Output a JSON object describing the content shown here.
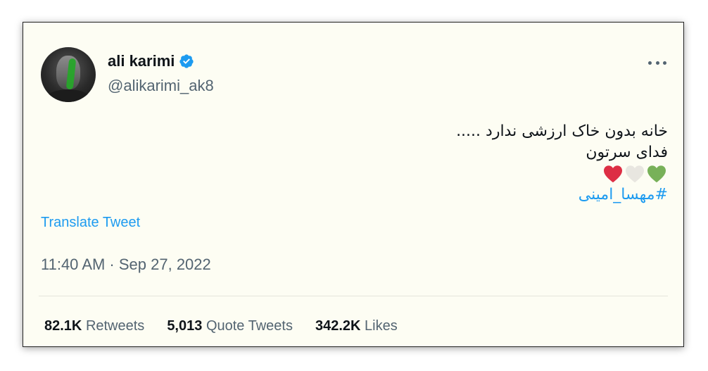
{
  "tweet": {
    "author": {
      "display_name": "ali karimi",
      "handle": "@alikarimi_ak8",
      "verified": true,
      "avatar_icon": "profile-photo-green-paint"
    },
    "more_icon": "ellipsis-icon",
    "body_lines": [
      "خانه بدون خاک ارزشی ندارد .....",
      "فدای سرتون"
    ],
    "emoji_hearts": [
      {
        "name": "green-heart",
        "color": "#78b159"
      },
      {
        "name": "white-heart",
        "color": "#e8e6e0"
      },
      {
        "name": "red-heart",
        "color": "#dd2e44"
      }
    ],
    "hashtag": "#مهسا_امینی",
    "translate_label": "Translate Tweet",
    "timestamp": "11:40 AM · Sep 27, 2022",
    "stats": [
      {
        "count": "82.1K",
        "label": "Retweets"
      },
      {
        "count": "5,013",
        "label": "Quote Tweets"
      },
      {
        "count": "342.2K",
        "label": "Likes"
      }
    ]
  },
  "colors": {
    "link": "#1d9bf0",
    "muted": "#536471",
    "text": "#0f1419",
    "background": "#fdfdf3"
  }
}
